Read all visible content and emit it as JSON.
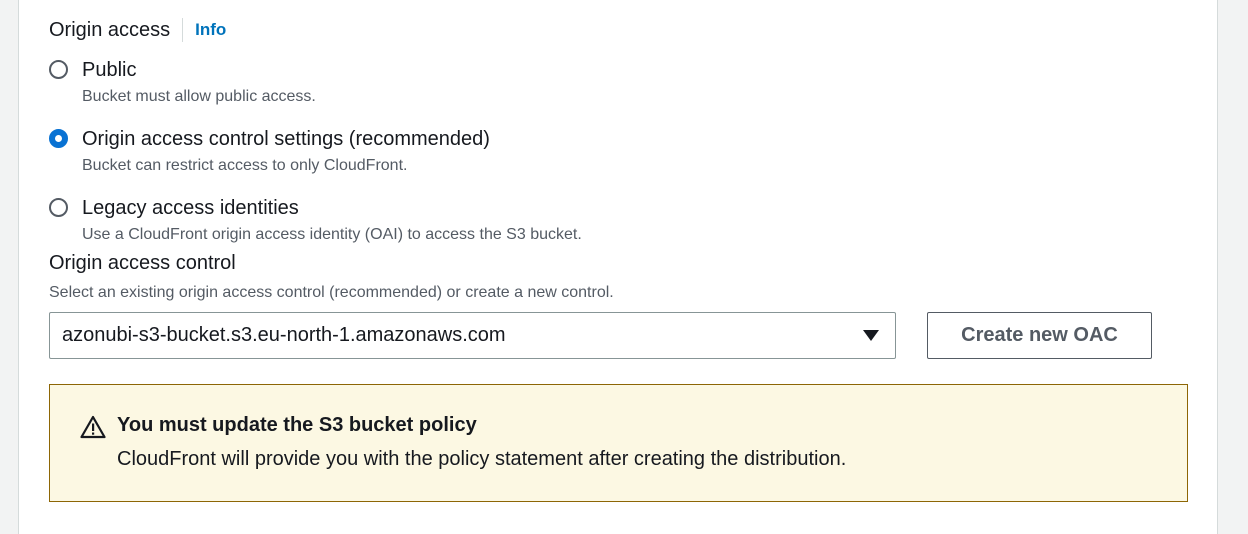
{
  "origin_access": {
    "label": "Origin access",
    "info_link": "Info",
    "options": [
      {
        "label": "Public",
        "description": "Bucket must allow public access.",
        "selected": false
      },
      {
        "label": "Origin access control settings (recommended)",
        "description": "Bucket can restrict access to only CloudFront.",
        "selected": true
      },
      {
        "label": "Legacy access identities",
        "description": "Use a CloudFront origin access identity (OAI) to access the S3 bucket.",
        "selected": false
      }
    ]
  },
  "origin_access_control": {
    "label": "Origin access control",
    "description": "Select an existing origin access control (recommended) or create a new control.",
    "selected_value": "azonubi-s3-bucket.s3.eu-north-1.amazonaws.com",
    "create_button": "Create new OAC"
  },
  "alert": {
    "icon": "warning-icon",
    "title": "You must update the S3 bucket policy",
    "body": "CloudFront will provide you with the policy statement after creating the distribution."
  },
  "colors": {
    "accent": "#0972d3",
    "link": "#0073bb",
    "warning_bg": "#fcf8e3",
    "warning_border": "#8d6605"
  }
}
